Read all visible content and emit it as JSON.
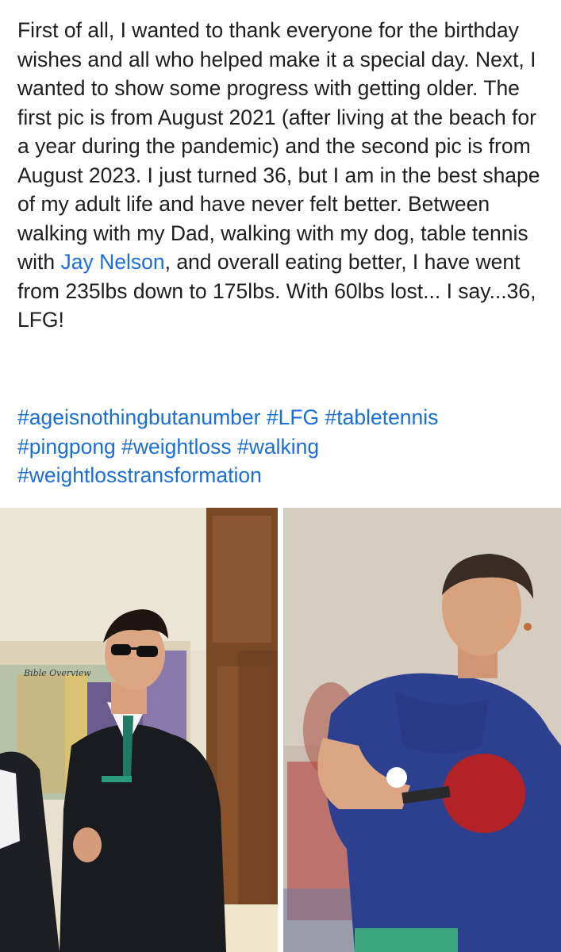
{
  "post": {
    "text_before_mention": "First of all, I wanted to thank everyone for the birthday wishes and all who helped make it a special day. Next, I wanted to show some progress with getting older. The first pic is from August 2021 (after living at the beach for a year during the pandemic) and the second pic is from August 2023. I just turned 36, but I am in the best shape of my adult life and have never felt better. Between walking with my Dad, walking with my dog, table tennis with ",
    "mention": "Jay Nelson",
    "text_after_mention": ", and overall eating better, I have went from 235lbs down to 175lbs. With 60lbs lost... I say...36, LFG!",
    "hashtags": [
      "#ageisnothingbutanumber",
      "#LFG",
      "#tabletennis",
      "#pingpong",
      "#weightloss",
      "#walking",
      "#weightlosstransformation"
    ]
  },
  "photos": [
    {
      "subject": "before-photo-man-in-black-suit-and-sunglasses",
      "sign_text": "Bible Overview"
    },
    {
      "subject": "after-photo-man-in-blue-shirt-playing-table-tennis"
    }
  ],
  "colors": {
    "text": "#1c1e21",
    "link": "#1a6ed8",
    "background": "#ffffff"
  }
}
